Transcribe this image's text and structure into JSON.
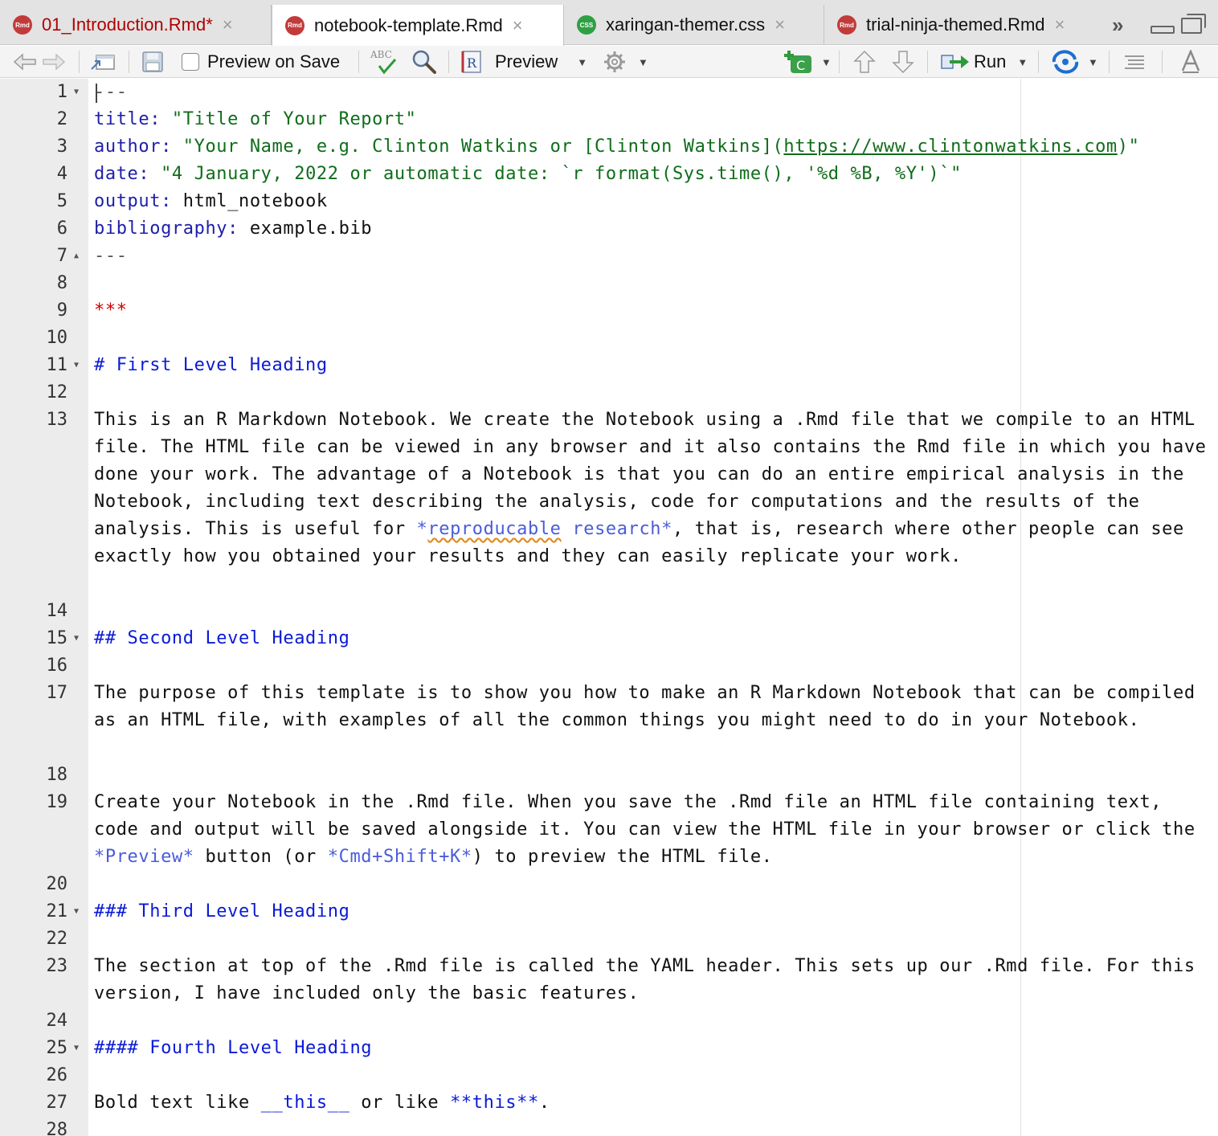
{
  "tabs": [
    {
      "label": "01_Introduction.Rmd*",
      "icon": "rmd-file-icon",
      "unsaved": true,
      "active": false
    },
    {
      "label": "notebook-template.Rmd",
      "icon": "rmd-file-icon",
      "unsaved": false,
      "active": true
    },
    {
      "label": "xaringan-themer.css",
      "icon": "css-file-icon",
      "unsaved": false,
      "active": false
    },
    {
      "label": "trial-ninja-themed.Rmd",
      "icon": "rmd-file-icon",
      "unsaved": false,
      "active": false
    }
  ],
  "file_icon_text": {
    "rmd": "Rmd",
    "css": "CSS"
  },
  "tab_close_glyph": "×",
  "toolbar": {
    "preview_on_save": "Preview on Save",
    "spellcheck_abc": "ABC",
    "preview": "Preview",
    "insert_chunk_letter": "C",
    "run": "Run",
    "knit_r_letter": "R"
  },
  "editor": {
    "lines": {
      "l1": "---",
      "l2_key": "title:",
      "l2_val": " \"Title of Your Report\"",
      "l3_key": "author:",
      "l3_val_a": " \"Your Name, e.g. Clinton Watkins or [Clinton Watkins](",
      "l3_url": "https://www.clintonwatkins.com",
      "l3_val_b": ")\"",
      "l4_key": "date:",
      "l4_val": " \"4 January, 2022 or automatic date: `r format(Sys.time(), '%d %B, %Y')`\"",
      "l5_key": "output:",
      "l5_val": " html_notebook",
      "l6_key": "bibliography:",
      "l6_val": " example.bib",
      "l7": "---",
      "l9": "***",
      "l11": "# First Level Heading",
      "l13_a": "This is an R Markdown Notebook. We create the Notebook using a .Rmd file that we compile to an HTML file. The HTML file can be viewed in any browser and it also contains the Rmd file in which you have done your work. The advantage of a Notebook is that you can do an entire empirical analysis in the Notebook, including text describing the analysis, code for computations and the results of the analysis. This is useful for ",
      "l13_em_a": "*",
      "l13_em_word": "reproducable",
      "l13_em_b": " research*",
      "l13_b": ", that is, research where other people can see exactly how you obtained your results and they can easily replicate your work.",
      "l15": "## Second Level Heading",
      "l17": "The purpose of this template is to show you how to make an R Markdown Notebook that can be compiled as an HTML file, with examples of all the common things you might need to do in your Notebook.",
      "l19_a": "Create your Notebook in the .Rmd file. When you save the .Rmd file an HTML file containing text, code and output will be saved alongside it. You can view the HTML file in your browser or click the ",
      "l19_em1": "*Preview*",
      "l19_b": " button (or ",
      "l19_em2": "*Cmd+Shift+K*",
      "l19_c": ") to preview the HTML file.",
      "l21": "### Third Level Heading",
      "l23": "The section at top of the .Rmd file is called the YAML header. This sets up our .Rmd file. For this version, I have included only the basic features.",
      "l25": "#### Fourth Level Heading",
      "l27_a": "Bold text like ",
      "l27_b1": "__this__",
      "l27_c": " or like ",
      "l27_b2": "**this**",
      "l27_d": "."
    },
    "line_numbers": [
      "1",
      "2",
      "3",
      "4",
      "5",
      "6",
      "7",
      "8",
      "9",
      "10",
      "11",
      "12",
      "13",
      "14",
      "15",
      "16",
      "17",
      "18",
      "19",
      "20",
      "21",
      "22",
      "23",
      "24",
      "25",
      "26",
      "27",
      "28"
    ]
  },
  "colors": {
    "yaml_key": "#1f1fa8",
    "yaml_string": "#0f6d1a",
    "heading": "#0a1ad6",
    "emphasis": "#4a5cdb",
    "hr": "#d00000",
    "unsaved_tab": "#b00000"
  }
}
